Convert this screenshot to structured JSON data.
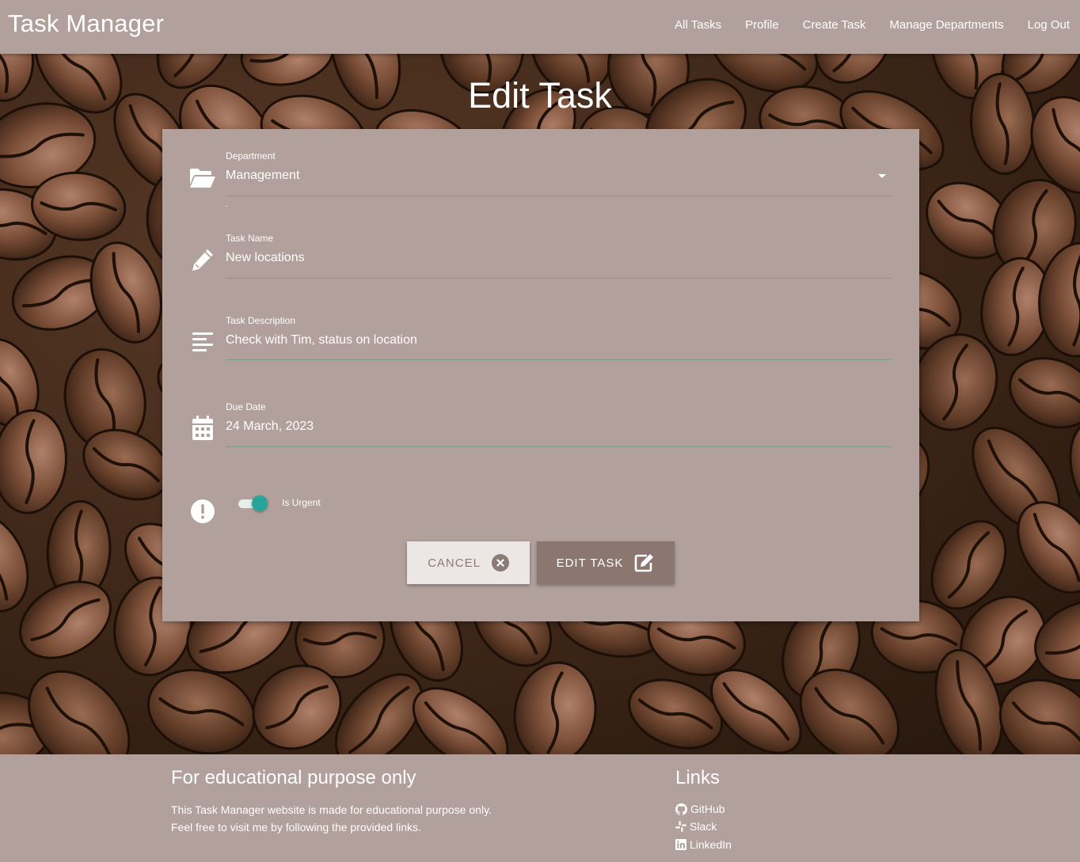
{
  "app": {
    "brand": "Task Manager"
  },
  "nav": {
    "links": [
      "All Tasks",
      "Profile",
      "Create Task",
      "Manage Departments",
      "Log Out"
    ]
  },
  "page": {
    "title": "Edit Task"
  },
  "form": {
    "department": {
      "label": "Department",
      "value": "Management",
      "hint": "."
    },
    "task_name": {
      "label": "Task Name",
      "value": "New locations"
    },
    "task_description": {
      "label": "Task Description",
      "value": "Check with Tim, status on location"
    },
    "due_date": {
      "label": "Due Date",
      "value": "24 March, 2023"
    },
    "is_urgent": {
      "label": "Is Urgent",
      "checked": true
    },
    "cancel_label": "CANCEL",
    "submit_label": "EDIT TASK"
  },
  "icons": {
    "department": "folder-open-icon",
    "task_name": "pencil-icon",
    "task_description": "align-left-icon",
    "due_date": "calendar-icon",
    "is_urgent": "exclamation-circle-icon",
    "cancel": "times-circle-icon",
    "submit": "edit-icon"
  },
  "colors": {
    "primary": "#b1a09b",
    "accent": "#26a69a",
    "submit": "#8c7670",
    "cancel_bg": "#ece7e4"
  },
  "footer": {
    "about_title": "For educational purpose only",
    "about_line1": "This Task Manager website is made for educational purpose only.",
    "about_line2": "Feel free to visit me by following the provided links.",
    "links_title": "Links",
    "links": [
      "GitHub",
      "Slack",
      "LinkedIn"
    ]
  }
}
